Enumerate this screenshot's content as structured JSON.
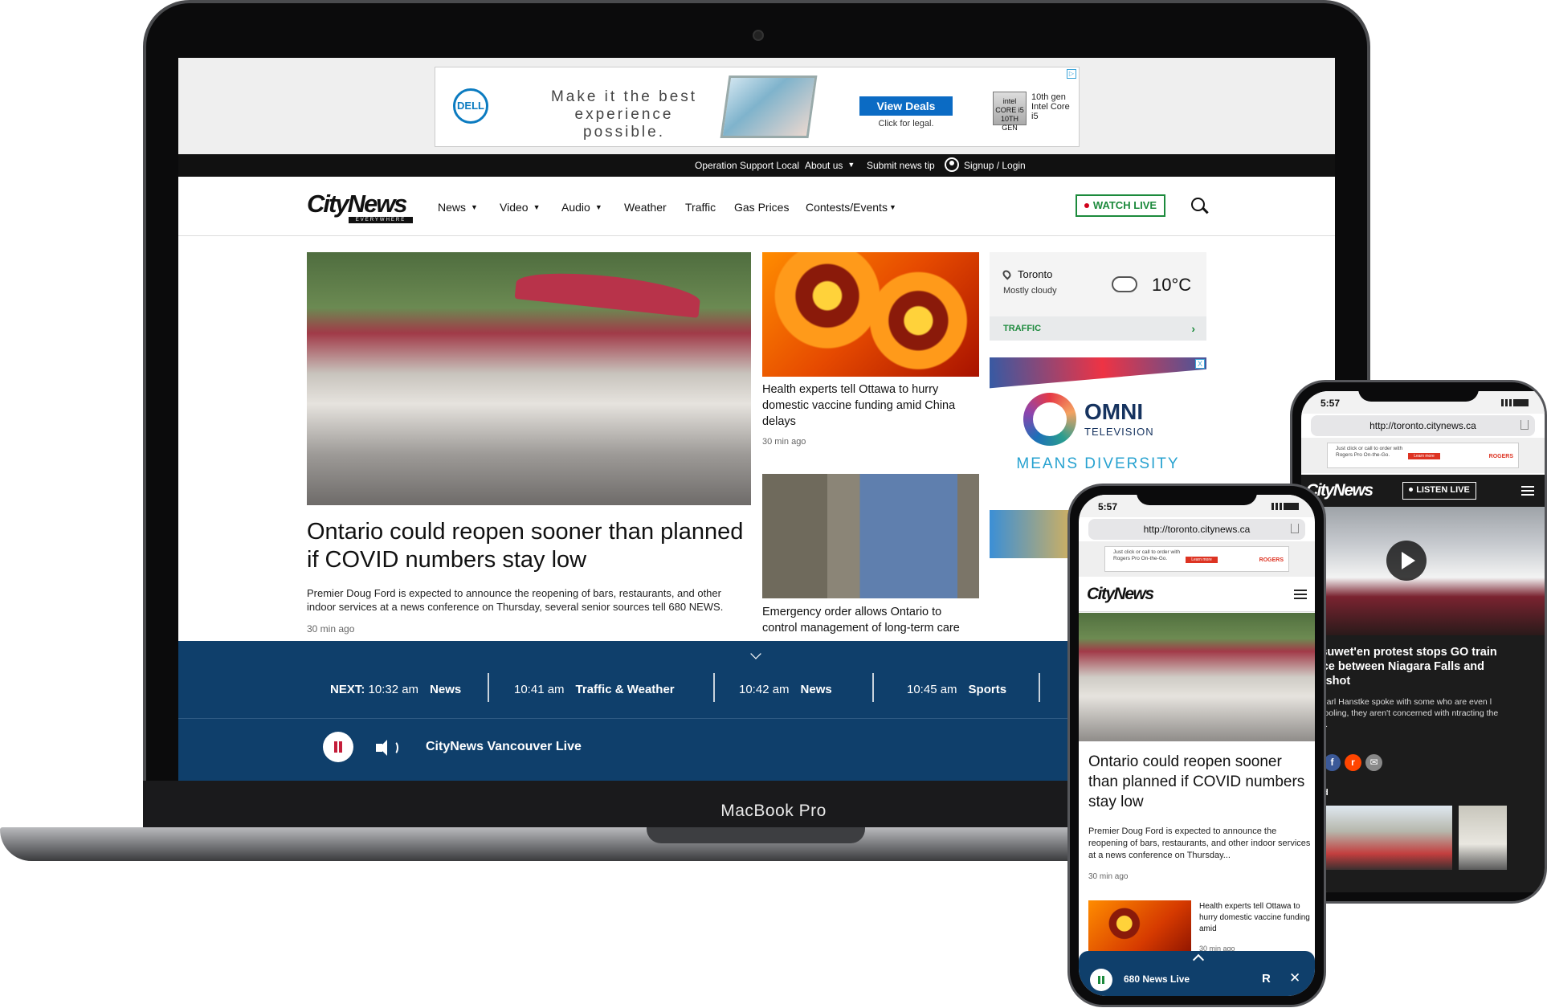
{
  "laptop": {
    "model_label": "MacBook Pro",
    "ad": {
      "brand": "DELL",
      "headline": "Make it the best experience possible.",
      "cta": "View Deals",
      "legal": "Click for legal.",
      "chip": "intel CORE i5 10TH GEN",
      "chip_text": "10th gen Intel Core i5",
      "adchoice": "▷"
    },
    "topbar": {
      "items": [
        "Operation Support Local",
        "About us",
        "Submit news tip",
        "Signup / Login"
      ]
    },
    "nav": {
      "brand": "CityNews",
      "brand_sub": "EVERYWHERE",
      "items": [
        "News",
        "Video",
        "Audio",
        "Weather",
        "Traffic",
        "Gas Prices",
        "Contests/Events"
      ],
      "watch_live": "WATCH LIVE"
    },
    "hero": {
      "title": "Ontario could reopen sooner than planned if COVID numbers stay low",
      "description": "Premier Doug Ford is expected to announce the reopening of bars, restaurants, and other indoor services at a news conference on Thursday, several senior sources tell 680 NEWS.",
      "time": "30 min ago"
    },
    "stories": [
      {
        "title": "Health experts tell Ottawa to hurry domestic vaccine funding amid China delays",
        "time": "30 min ago"
      },
      {
        "title": "Emergency order allows Ontario to control management of long-term care homes",
        "time": ""
      }
    ],
    "weather": {
      "city": "Toronto",
      "condition": "Mostly cloudy",
      "temp": "10°C",
      "traffic_label": "TRAFFIC"
    },
    "omni_ad": {
      "name": "OMNI",
      "sub": "TELEVISION",
      "tagline": "MEANS DIVERSITY",
      "close": "X"
    },
    "player": {
      "next_label": "NEXT:",
      "schedule": [
        {
          "time": "10:32 am",
          "show": "News"
        },
        {
          "time": "10:41 am",
          "show": "Traffic & Weather"
        },
        {
          "time": "10:42 am",
          "show": "News"
        },
        {
          "time": "10:45 am",
          "show": "Sports"
        }
      ],
      "station": "CityNews Vancouver Live"
    }
  },
  "phone_front": {
    "status_time": "5:57",
    "url": "http://toronto.citynews.ca",
    "ad_text": "Just click or call to order with Rogers Pro On-the-Go.",
    "ad_button": "Learn more",
    "ad_brand": "ROGERS",
    "brand": "CityNews",
    "hero_title": "Ontario could reopen sooner than planned if COVID numbers stay low",
    "hero_desc": "Premier Doug Ford is expected to announce the reopening of bars, restaurants, and other indoor services at a news conference on Thursday...",
    "hero_time": "30 min ago",
    "story_title": "Health experts tell Ottawa to hurry domestic vaccine funding amid",
    "story_time": "30 min ago",
    "player_station": "680 News Live",
    "player_r": "R",
    "player_close": "✕"
  },
  "phone_back": {
    "status_time": "5:57",
    "url": "http://toronto.citynews.ca",
    "ad_text": "Just click or call to order with Rogers Pro On-the-Go.",
    "ad_button": "Learn more",
    "ad_brand": "ROGERS",
    "brand": "CityNews",
    "listen_live": "LISTEN LIVE",
    "title": "et'suwet'en protest stops GO train rvice between Niagara Falls and dershot",
    "description": "0's Carl Hanstke spoke with some who are even l carpooling, they aren't concerned with ntracting the virus.",
    "time": "go",
    "share": [
      "t",
      "f",
      "r",
      "✉"
    ],
    "related": "lated"
  }
}
